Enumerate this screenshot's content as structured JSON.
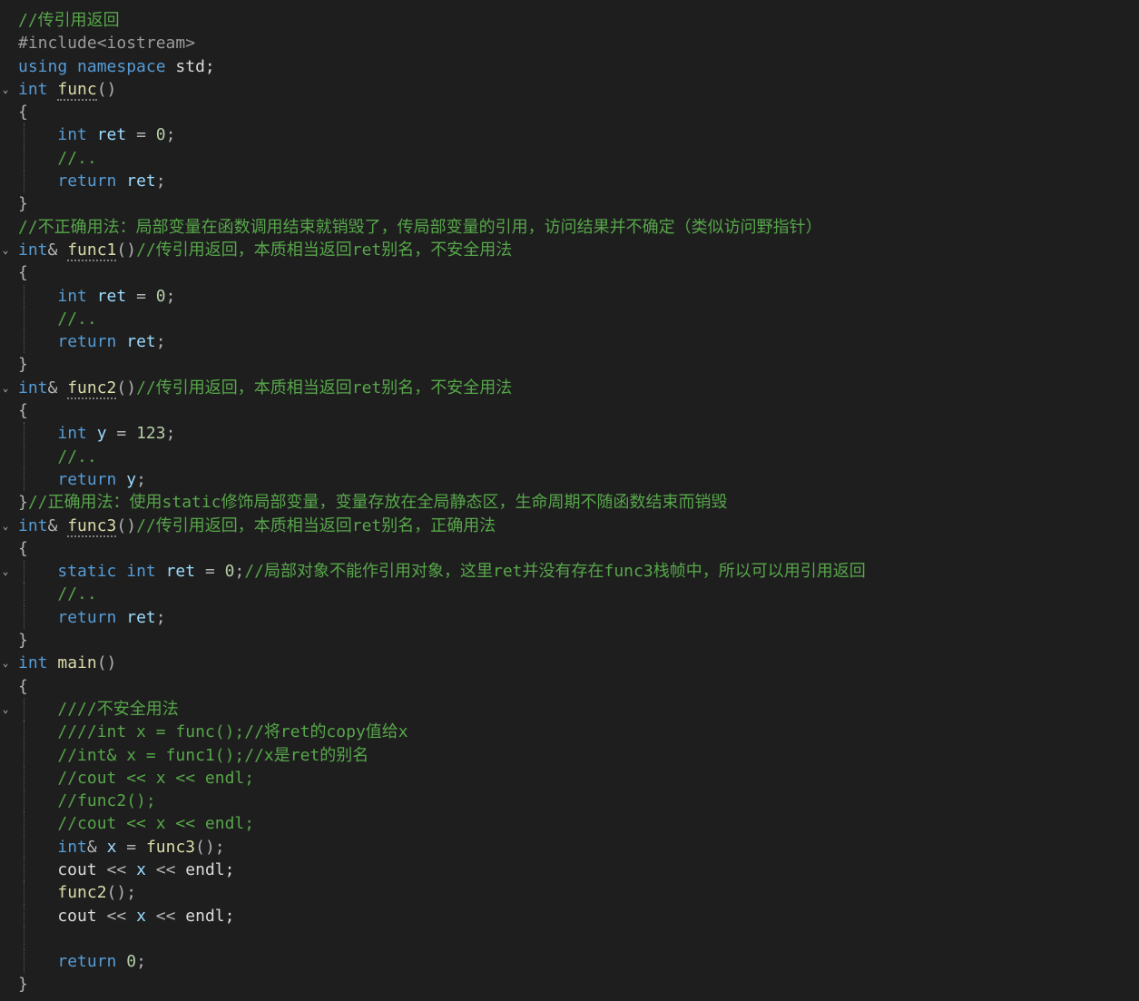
{
  "editor": {
    "language": "cpp",
    "fold_icon": "chevron-down-icon",
    "lines": [
      {
        "fold": false,
        "guides": [],
        "tokens": [
          {
            "t": "cm",
            "v": "//传引用返回"
          }
        ]
      },
      {
        "fold": false,
        "guides": [],
        "tokens": [
          {
            "t": "pp",
            "v": "#include<iostream>"
          }
        ]
      },
      {
        "fold": false,
        "guides": [],
        "tokens": [
          {
            "t": "kw",
            "v": "using"
          },
          {
            "t": "pl",
            "v": " "
          },
          {
            "t": "kw",
            "v": "namespace"
          },
          {
            "t": "pl",
            "v": " std;"
          }
        ]
      },
      {
        "fold": true,
        "guides": [],
        "tokens": [
          {
            "t": "ty",
            "v": "int"
          },
          {
            "t": "pl",
            "v": " "
          },
          {
            "t": "fn",
            "v": "func",
            "d": true
          },
          {
            "t": "pn",
            "v": "()"
          }
        ]
      },
      {
        "fold": false,
        "guides": [],
        "tokens": [
          {
            "t": "pn",
            "v": "{"
          }
        ]
      },
      {
        "fold": false,
        "guides": [
          0
        ],
        "tokens": [
          {
            "t": "pl",
            "v": "    "
          },
          {
            "t": "ty",
            "v": "int"
          },
          {
            "t": "pl",
            "v": " "
          },
          {
            "t": "vr",
            "v": "ret"
          },
          {
            "t": "pl",
            "v": " "
          },
          {
            "t": "op",
            "v": "="
          },
          {
            "t": "pl",
            "v": " "
          },
          {
            "t": "nm",
            "v": "0"
          },
          {
            "t": "pn",
            "v": ";"
          }
        ]
      },
      {
        "fold": false,
        "guides": [
          0
        ],
        "tokens": [
          {
            "t": "pl",
            "v": "    "
          },
          {
            "t": "cm",
            "v": "//.."
          }
        ]
      },
      {
        "fold": false,
        "guides": [
          0
        ],
        "tokens": [
          {
            "t": "pl",
            "v": "    "
          },
          {
            "t": "kw",
            "v": "return"
          },
          {
            "t": "pl",
            "v": " "
          },
          {
            "t": "vr",
            "v": "ret"
          },
          {
            "t": "pn",
            "v": ";"
          }
        ]
      },
      {
        "fold": false,
        "guides": [],
        "tokens": [
          {
            "t": "pn",
            "v": "}"
          }
        ]
      },
      {
        "fold": false,
        "guides": [],
        "tokens": [
          {
            "t": "cm",
            "v": "//不正确用法：局部变量在函数调用结束就销毁了，传局部变量的引用，访问结果并不确定（类似访问野指针）"
          }
        ]
      },
      {
        "fold": true,
        "guides": [],
        "tokens": [
          {
            "t": "ty",
            "v": "int"
          },
          {
            "t": "op",
            "v": "&"
          },
          {
            "t": "pl",
            "v": " "
          },
          {
            "t": "fn",
            "v": "func1",
            "d": true
          },
          {
            "t": "pn",
            "v": "()"
          },
          {
            "t": "cm",
            "v": "//传引用返回，本质相当返回ret别名，不安全用法"
          }
        ]
      },
      {
        "fold": false,
        "guides": [],
        "tokens": [
          {
            "t": "pn",
            "v": "{"
          }
        ]
      },
      {
        "fold": false,
        "guides": [
          0
        ],
        "tokens": [
          {
            "t": "pl",
            "v": "    "
          },
          {
            "t": "ty",
            "v": "int"
          },
          {
            "t": "pl",
            "v": " "
          },
          {
            "t": "vr",
            "v": "ret"
          },
          {
            "t": "pl",
            "v": " "
          },
          {
            "t": "op",
            "v": "="
          },
          {
            "t": "pl",
            "v": " "
          },
          {
            "t": "nm",
            "v": "0"
          },
          {
            "t": "pn",
            "v": ";"
          }
        ]
      },
      {
        "fold": false,
        "guides": [
          0
        ],
        "tokens": [
          {
            "t": "pl",
            "v": "    "
          },
          {
            "t": "cm",
            "v": "//.."
          }
        ]
      },
      {
        "fold": false,
        "guides": [
          0
        ],
        "tokens": [
          {
            "t": "pl",
            "v": "    "
          },
          {
            "t": "kw",
            "v": "return"
          },
          {
            "t": "pl",
            "v": " "
          },
          {
            "t": "vr",
            "v": "ret"
          },
          {
            "t": "pn",
            "v": ";"
          }
        ]
      },
      {
        "fold": false,
        "guides": [],
        "tokens": [
          {
            "t": "pn",
            "v": "}"
          }
        ]
      },
      {
        "fold": true,
        "guides": [],
        "tokens": [
          {
            "t": "ty",
            "v": "int"
          },
          {
            "t": "op",
            "v": "&"
          },
          {
            "t": "pl",
            "v": " "
          },
          {
            "t": "fn",
            "v": "func2",
            "d": true
          },
          {
            "t": "pn",
            "v": "()"
          },
          {
            "t": "cm",
            "v": "//传引用返回，本质相当返回ret别名，不安全用法"
          }
        ]
      },
      {
        "fold": false,
        "guides": [],
        "tokens": [
          {
            "t": "pn",
            "v": "{"
          }
        ]
      },
      {
        "fold": false,
        "guides": [
          0
        ],
        "tokens": [
          {
            "t": "pl",
            "v": "    "
          },
          {
            "t": "ty",
            "v": "int"
          },
          {
            "t": "pl",
            "v": " "
          },
          {
            "t": "vr",
            "v": "y"
          },
          {
            "t": "pl",
            "v": " "
          },
          {
            "t": "op",
            "v": "="
          },
          {
            "t": "pl",
            "v": " "
          },
          {
            "t": "nm",
            "v": "123"
          },
          {
            "t": "pn",
            "v": ";"
          }
        ]
      },
      {
        "fold": false,
        "guides": [
          0
        ],
        "tokens": [
          {
            "t": "pl",
            "v": "    "
          },
          {
            "t": "cm",
            "v": "//.."
          }
        ]
      },
      {
        "fold": false,
        "guides": [
          0
        ],
        "tokens": [
          {
            "t": "pl",
            "v": "    "
          },
          {
            "t": "kw",
            "v": "return"
          },
          {
            "t": "pl",
            "v": " "
          },
          {
            "t": "vr",
            "v": "y"
          },
          {
            "t": "pn",
            "v": ";"
          }
        ]
      },
      {
        "fold": false,
        "guides": [],
        "tokens": [
          {
            "t": "pn",
            "v": "}"
          },
          {
            "t": "cm",
            "v": "//正确用法：使用static修饰局部变量，变量存放在全局静态区，生命周期不随函数结束而销毁"
          }
        ]
      },
      {
        "fold": true,
        "guides": [],
        "tokens": [
          {
            "t": "ty",
            "v": "int"
          },
          {
            "t": "op",
            "v": "&"
          },
          {
            "t": "pl",
            "v": " "
          },
          {
            "t": "fn",
            "v": "func3",
            "d": true
          },
          {
            "t": "pn",
            "v": "()"
          },
          {
            "t": "cm",
            "v": "//传引用返回，本质相当返回ret别名，正确用法"
          }
        ]
      },
      {
        "fold": false,
        "guides": [],
        "tokens": [
          {
            "t": "pn",
            "v": "{"
          }
        ]
      },
      {
        "fold": true,
        "guides": [
          0
        ],
        "tokens": [
          {
            "t": "pl",
            "v": "    "
          },
          {
            "t": "kw",
            "v": "static"
          },
          {
            "t": "pl",
            "v": " "
          },
          {
            "t": "ty",
            "v": "int"
          },
          {
            "t": "pl",
            "v": " "
          },
          {
            "t": "vr",
            "v": "ret"
          },
          {
            "t": "pl",
            "v": " "
          },
          {
            "t": "op",
            "v": "="
          },
          {
            "t": "pl",
            "v": " "
          },
          {
            "t": "nm",
            "v": "0"
          },
          {
            "t": "pn",
            "v": ";"
          },
          {
            "t": "cm",
            "v": "//局部对象不能作引用对象，这里ret并没有存在func3栈帧中，所以可以用引用返回"
          }
        ]
      },
      {
        "fold": false,
        "guides": [
          0
        ],
        "tokens": [
          {
            "t": "pl",
            "v": "    "
          },
          {
            "t": "cm",
            "v": "//.."
          }
        ]
      },
      {
        "fold": false,
        "guides": [
          0
        ],
        "tokens": [
          {
            "t": "pl",
            "v": "    "
          },
          {
            "t": "kw",
            "v": "return"
          },
          {
            "t": "pl",
            "v": " "
          },
          {
            "t": "vr",
            "v": "ret"
          },
          {
            "t": "pn",
            "v": ";"
          }
        ]
      },
      {
        "fold": false,
        "guides": [],
        "tokens": [
          {
            "t": "pn",
            "v": "}"
          }
        ]
      },
      {
        "fold": true,
        "guides": [],
        "tokens": [
          {
            "t": "ty",
            "v": "int"
          },
          {
            "t": "pl",
            "v": " "
          },
          {
            "t": "fn",
            "v": "main"
          },
          {
            "t": "pn",
            "v": "()"
          }
        ]
      },
      {
        "fold": false,
        "guides": [],
        "tokens": [
          {
            "t": "pn",
            "v": "{"
          }
        ]
      },
      {
        "fold": true,
        "guides": [
          0
        ],
        "tokens": [
          {
            "t": "pl",
            "v": "    "
          },
          {
            "t": "cm",
            "v": "////不安全用法"
          }
        ]
      },
      {
        "fold": false,
        "guides": [
          0
        ],
        "tokens": [
          {
            "t": "pl",
            "v": "    "
          },
          {
            "t": "cm",
            "v": "////int x = func();//将ret的copy值给x"
          }
        ]
      },
      {
        "fold": false,
        "guides": [
          0
        ],
        "tokens": [
          {
            "t": "pl",
            "v": "    "
          },
          {
            "t": "cm",
            "v": "//int& x = func1();//x是ret的别名"
          }
        ]
      },
      {
        "fold": false,
        "guides": [
          0
        ],
        "tokens": [
          {
            "t": "pl",
            "v": "    "
          },
          {
            "t": "cm",
            "v": "//cout << x << endl;"
          }
        ]
      },
      {
        "fold": false,
        "guides": [
          0
        ],
        "tokens": [
          {
            "t": "pl",
            "v": "    "
          },
          {
            "t": "cm",
            "v": "//func2();"
          }
        ]
      },
      {
        "fold": false,
        "guides": [
          0
        ],
        "tokens": [
          {
            "t": "pl",
            "v": "    "
          },
          {
            "t": "cm",
            "v": "//cout << x << endl;"
          }
        ]
      },
      {
        "fold": false,
        "guides": [
          0
        ],
        "tokens": [
          {
            "t": "pl",
            "v": "    "
          },
          {
            "t": "ty",
            "v": "int"
          },
          {
            "t": "op",
            "v": "&"
          },
          {
            "t": "pl",
            "v": " "
          },
          {
            "t": "vr",
            "v": "x"
          },
          {
            "t": "pl",
            "v": " "
          },
          {
            "t": "op",
            "v": "="
          },
          {
            "t": "pl",
            "v": " "
          },
          {
            "t": "fn",
            "v": "func3"
          },
          {
            "t": "pn",
            "v": "();"
          }
        ]
      },
      {
        "fold": false,
        "guides": [
          0
        ],
        "tokens": [
          {
            "t": "pl",
            "v": "    cout "
          },
          {
            "t": "op",
            "v": "<<"
          },
          {
            "t": "pl",
            "v": " "
          },
          {
            "t": "vr",
            "v": "x"
          },
          {
            "t": "pl",
            "v": " "
          },
          {
            "t": "op",
            "v": "<<"
          },
          {
            "t": "pl",
            "v": " endl;"
          }
        ]
      },
      {
        "fold": false,
        "guides": [
          0
        ],
        "tokens": [
          {
            "t": "pl",
            "v": "    "
          },
          {
            "t": "fn",
            "v": "func2"
          },
          {
            "t": "pn",
            "v": "();"
          }
        ]
      },
      {
        "fold": false,
        "guides": [
          0
        ],
        "tokens": [
          {
            "t": "pl",
            "v": "    cout "
          },
          {
            "t": "op",
            "v": "<<"
          },
          {
            "t": "pl",
            "v": " "
          },
          {
            "t": "vr",
            "v": "x"
          },
          {
            "t": "pl",
            "v": " "
          },
          {
            "t": "op",
            "v": "<<"
          },
          {
            "t": "pl",
            "v": " endl;"
          }
        ]
      },
      {
        "fold": false,
        "guides": [
          0
        ],
        "tokens": [
          {
            "t": "pl",
            "v": ""
          }
        ]
      },
      {
        "fold": false,
        "guides": [
          0
        ],
        "tokens": [
          {
            "t": "pl",
            "v": "    "
          },
          {
            "t": "kw",
            "v": "return"
          },
          {
            "t": "pl",
            "v": " "
          },
          {
            "t": "nm",
            "v": "0"
          },
          {
            "t": "pn",
            "v": ";"
          }
        ]
      },
      {
        "fold": false,
        "guides": [],
        "tokens": [
          {
            "t": "pn",
            "v": "}"
          }
        ]
      }
    ]
  }
}
